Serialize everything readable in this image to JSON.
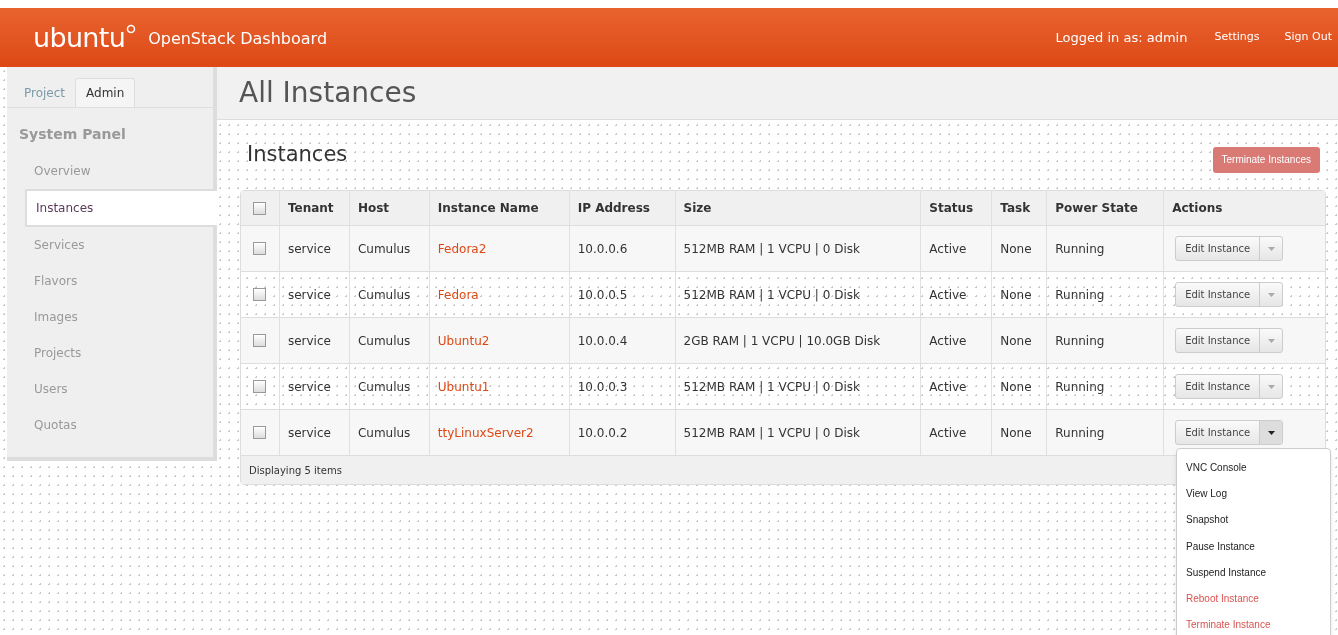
{
  "header": {
    "logo": "ubuntu",
    "title": "OpenStack Dashboard",
    "user": "Logged in as: admin",
    "links": [
      "Settings",
      "Sign Out"
    ]
  },
  "sidebar": {
    "tabs": [
      {
        "label": "Project",
        "selected": false
      },
      {
        "label": "Admin",
        "selected": true
      }
    ],
    "panel_title": "System Panel",
    "items": [
      {
        "label": "Overview",
        "selected": false
      },
      {
        "label": "Instances",
        "selected": true
      },
      {
        "label": "Services",
        "selected": false
      },
      {
        "label": "Flavors",
        "selected": false
      },
      {
        "label": "Images",
        "selected": false
      },
      {
        "label": "Projects",
        "selected": false
      },
      {
        "label": "Users",
        "selected": false
      },
      {
        "label": "Quotas",
        "selected": false
      }
    ]
  },
  "page_title": "All Instances",
  "section_title": "Instances",
  "terminate_button": "Terminate Instances",
  "table": {
    "select_all_checked": false,
    "columns": [
      "Tenant",
      "Host",
      "Instance Name",
      "IP Address",
      "Size",
      "Status",
      "Task",
      "Power State",
      "Actions"
    ],
    "rows": [
      {
        "checked": false,
        "tenant": "service",
        "host": "Cumulus",
        "name": "Fedora2",
        "ip": "10.0.0.6",
        "size": "512MB RAM | 1 VCPU | 0 Disk",
        "status": "Active",
        "task": "None",
        "power": "Running",
        "action": "Edit Instance",
        "menu_open": false
      },
      {
        "checked": false,
        "tenant": "service",
        "host": "Cumulus",
        "name": "Fedora",
        "ip": "10.0.0.5",
        "size": "512MB RAM | 1 VCPU | 0 Disk",
        "status": "Active",
        "task": "None",
        "power": "Running",
        "action": "Edit Instance",
        "menu_open": false
      },
      {
        "checked": false,
        "tenant": "service",
        "host": "Cumulus",
        "name": "Ubuntu2",
        "ip": "10.0.0.4",
        "size": "2GB RAM | 1 VCPU | 10.0GB Disk",
        "status": "Active",
        "task": "None",
        "power": "Running",
        "action": "Edit Instance",
        "menu_open": false
      },
      {
        "checked": false,
        "tenant": "service",
        "host": "Cumulus",
        "name": "Ubuntu1",
        "ip": "10.0.0.3",
        "size": "512MB RAM | 1 VCPU | 0 Disk",
        "status": "Active",
        "task": "None",
        "power": "Running",
        "action": "Edit Instance",
        "menu_open": false
      },
      {
        "checked": false,
        "tenant": "service",
        "host": "Cumulus",
        "name": "ttyLinuxServer2",
        "ip": "10.0.0.2",
        "size": "512MB RAM | 1 VCPU | 0 Disk",
        "status": "Active",
        "task": "None",
        "power": "Running",
        "action": "Edit Instance",
        "menu_open": true
      }
    ],
    "footer": "Displaying 5 items"
  },
  "action_menu": [
    {
      "label": "VNC Console",
      "kind": "normal"
    },
    {
      "label": "View Log",
      "kind": "normal"
    },
    {
      "label": "Snapshot",
      "kind": "normal"
    },
    {
      "label": "Pause Instance",
      "kind": "normal"
    },
    {
      "label": "Suspend Instance",
      "kind": "normal"
    },
    {
      "label": "Reboot Instance",
      "kind": "danger"
    },
    {
      "label": "Terminate Instance",
      "kind": "danger"
    }
  ]
}
